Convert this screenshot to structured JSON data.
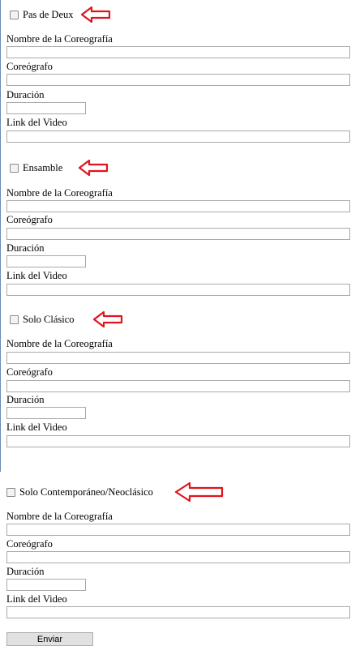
{
  "form": {
    "sections": [
      {
        "checkbox_label": "Pas de Deux",
        "fields": {
          "nombre_label": "Nombre de la Coreografía",
          "nombre_value": "",
          "coreografo_label": "Coreógrafo",
          "coreografo_value": "",
          "duracion_label": "Duración",
          "duracion_value": "",
          "link_label": "Link del Video",
          "link_value": ""
        }
      },
      {
        "checkbox_label": "Ensamble",
        "fields": {
          "nombre_label": "Nombre de la Coreografía",
          "nombre_value": "",
          "coreografo_label": "Coreógrafo",
          "coreografo_value": "",
          "duracion_label": "Duración",
          "duracion_value": "",
          "link_label": "Link del Video",
          "link_value": ""
        }
      },
      {
        "checkbox_label": "Solo Clásico",
        "fields": {
          "nombre_label": "Nombre de la Coreografía",
          "nombre_value": "",
          "coreografo_label": "Coreógrafo",
          "coreografo_value": "",
          "duracion_label": "Duración",
          "duracion_value": "",
          "link_label": "Link del Video",
          "link_value": ""
        }
      },
      {
        "checkbox_label": "Solo Contemporáneo/Neoclásico",
        "fields": {
          "nombre_label": "Nombre de la Coreografía",
          "nombre_value": "",
          "coreografo_label": "Coreógrafo",
          "coreografo_value": "",
          "duracion_label": "Duración",
          "duracion_value": "",
          "link_label": "Link del Video",
          "link_value": ""
        }
      }
    ],
    "submit_label": "Enviar"
  },
  "colors": {
    "annotation_arrow": "#e0141e",
    "input_border": "#a9a9a9",
    "button_bg": "#e1e1e1"
  },
  "icons": {
    "annotation": "left-arrow-outline-icon"
  }
}
